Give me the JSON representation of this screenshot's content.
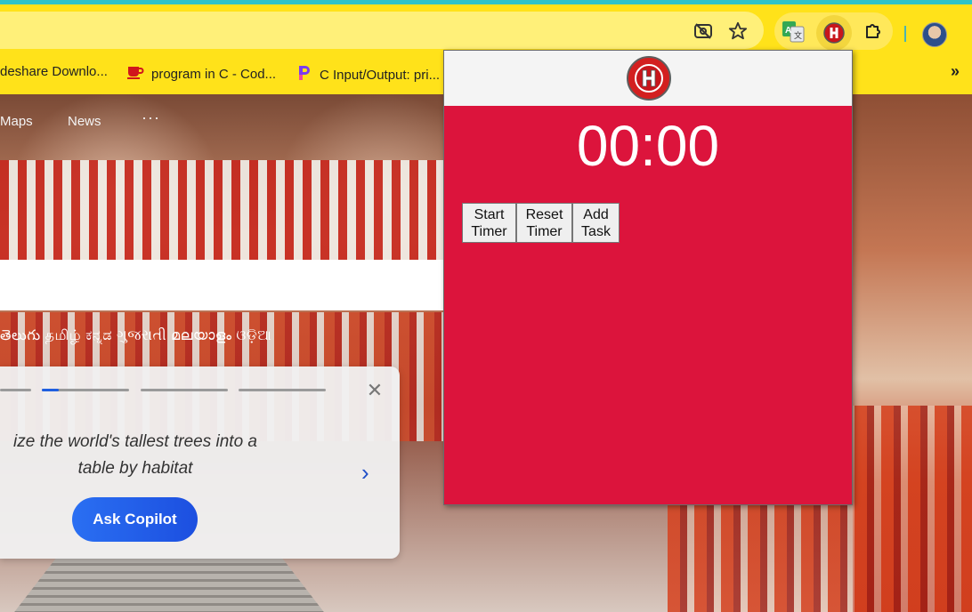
{
  "browser": {
    "bookmarks": [
      {
        "label": "deshare Downlo..."
      },
      {
        "label": "program in C - Cod..."
      },
      {
        "label": "C Input/Output: pri..."
      }
    ],
    "more_glyph": "»"
  },
  "page": {
    "nav": {
      "maps": "Maps",
      "news": "News",
      "more": "···"
    },
    "languages": "తెలుగు  தமிழ்  ಕನ್ನಡ  ગુજરાતી  മലയാളം  ଓଡ଼ିଆ",
    "copilot_card": {
      "text": "ize the world's tallest trees into a table by habitat",
      "button": "Ask Copilot",
      "close": "✕",
      "next": "›",
      "progress_total": 4,
      "progress_active_index": 1
    }
  },
  "popup": {
    "timer": "00:00",
    "buttons": {
      "start": "Start\nTimer",
      "reset": "Reset\nTimer",
      "add": "Add\nTask"
    },
    "colors": {
      "background": "#dc143c",
      "header": "#f4f4f4"
    }
  }
}
